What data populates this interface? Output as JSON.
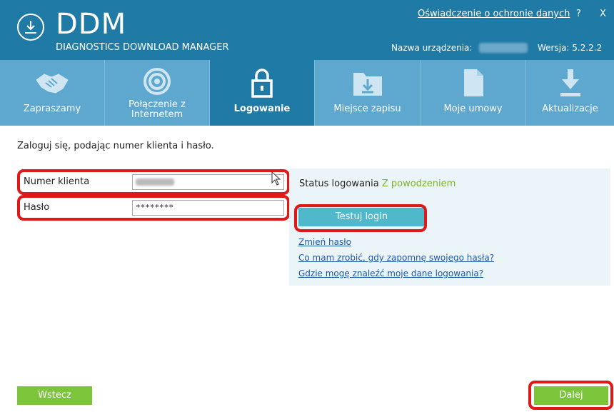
{
  "header": {
    "app_title": "DDM",
    "app_subtitle": "DIAGNOSTICS DOWNLOAD MANAGER",
    "privacy_link": "Oświadczenie o ochronie danych",
    "help": "?",
    "close": "X",
    "device_label": "Nazwa urządzenia:",
    "version_label": "Wersja:  5.2.2.2"
  },
  "tabs": [
    {
      "label": "Zapraszamy",
      "icon": "handshake-icon"
    },
    {
      "label": "Połączenie z Internetem",
      "icon": "wifi-icon"
    },
    {
      "label": "Logowanie",
      "icon": "lock-icon",
      "active": true
    },
    {
      "label": "Miejsce zapisu",
      "icon": "folder-download-icon"
    },
    {
      "label": "Moje umowy",
      "icon": "document-icon"
    },
    {
      "label": "Aktualizacje",
      "icon": "download-icon"
    }
  ],
  "login": {
    "instruction": "Zaloguj się, podając numer klienta i hasło.",
    "customer_label": "Numer klienta",
    "password_label": "Hasło",
    "password_value": "********"
  },
  "status": {
    "label": "Status logowania",
    "value": "Z powodzeniem",
    "test_button": "Testuj login",
    "links": [
      "Zmień hasło",
      "Co mam zrobić, gdy zapomnę swojego hasła?",
      "Gdzie mogę znaleźć moje dane logowania?"
    ]
  },
  "footer": {
    "back_button": "Wstecz",
    "next_button": "Dalej"
  },
  "colors": {
    "header": "#1f7aa6",
    "tabbar": "#5ea8d0",
    "accent_green": "#7cc43a",
    "test_button": "#4fb9cb",
    "highlight": "#e01818"
  }
}
